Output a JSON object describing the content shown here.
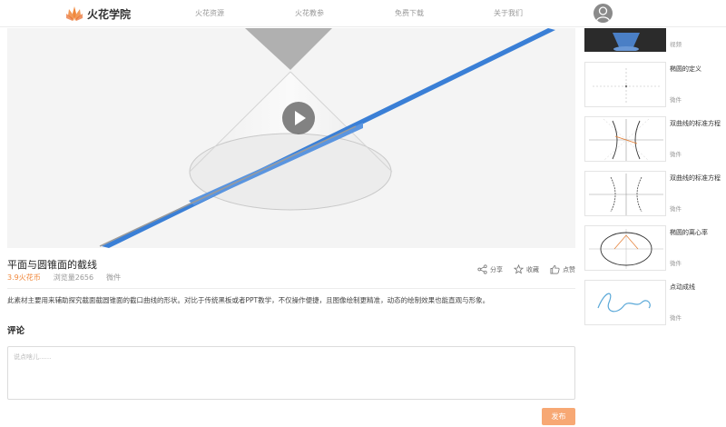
{
  "header": {
    "logo_text": "火花学院",
    "nav": [
      "火花资源",
      "火花教参",
      "免费下载",
      "关于我们"
    ]
  },
  "video": {
    "title": "平面与圆锥面的截线"
  },
  "meta": {
    "coins": "3.9火花币",
    "views": "浏览量2656",
    "tag": "微件"
  },
  "actions": {
    "share": "分享",
    "favorite": "收藏",
    "like": "点赞"
  },
  "description": "此素材主要用来辅助探究截面截圆锥面的截口曲线的形状。对比于传统黑板或者PPT教学，不仅操作便捷，且图像绘制更精准，动态的绘制效果也能直观与形象。",
  "comments": {
    "title": "评论",
    "placeholder": "说点啥儿......",
    "publish": "发布"
  },
  "sidebar": {
    "items": [
      {
        "title": "",
        "tag": "视频"
      },
      {
        "title": "椭圆的定义",
        "tag": "微件"
      },
      {
        "title": "双曲线的标准方程",
        "tag": "微件"
      },
      {
        "title": "双曲线的标准方程",
        "tag": "微件"
      },
      {
        "title": "椭圆的离心率",
        "tag": "微件"
      },
      {
        "title": "点动成线",
        "tag": "微件"
      }
    ]
  },
  "colors": {
    "accent": "#f0883c",
    "publish_button": "#f7a874",
    "plane_blue": "#3a7fd6"
  }
}
